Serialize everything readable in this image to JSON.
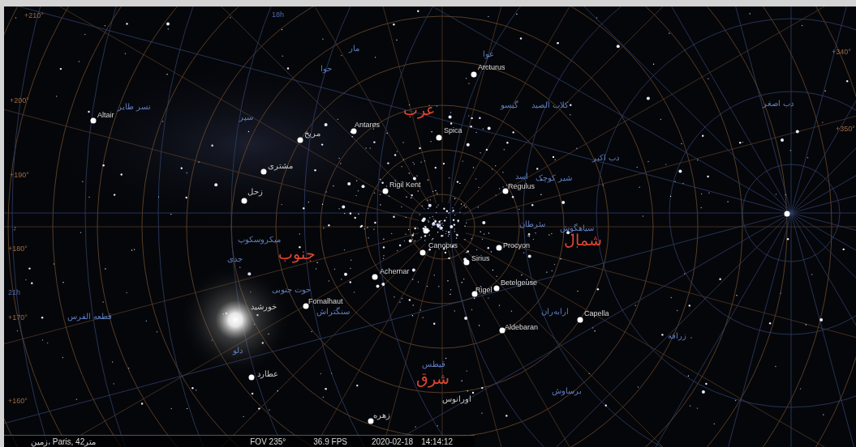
{
  "sky": {
    "labels": [
      {
        "kind": "hour",
        "text": "18h"
      },
      {
        "kind": "grid",
        "text": "+210°"
      },
      {
        "kind": "grid",
        "text": "+340°"
      },
      {
        "kind": "constellation",
        "text": "عوا"
      },
      {
        "kind": "constellation",
        "text": "مار"
      },
      {
        "kind": "star",
        "text": "Arcturus"
      },
      {
        "kind": "constellation",
        "text": "حوا"
      },
      {
        "kind": "constellation",
        "text": "دب اصغر"
      },
      {
        "kind": "constellation",
        "text": "کلاب الصید"
      },
      {
        "kind": "constellation",
        "text": "گیسو"
      },
      {
        "kind": "cardinal",
        "text": "غرب"
      },
      {
        "kind": "constellation",
        "text": "نسر طایر"
      },
      {
        "kind": "grid",
        "text": "+200°"
      },
      {
        "kind": "constellation",
        "text": "سپر"
      },
      {
        "kind": "star",
        "text": "Altair"
      },
      {
        "kind": "grid",
        "text": "+350°"
      },
      {
        "kind": "star",
        "text": "Spica"
      },
      {
        "kind": "star",
        "text": "Antares"
      },
      {
        "kind": "planet",
        "text": "مریخ"
      },
      {
        "kind": "constellation",
        "text": "دب اکبر"
      },
      {
        "kind": "planet",
        "text": "مشتری"
      },
      {
        "kind": "constellation",
        "text": "شیر کوچک"
      },
      {
        "kind": "constellation",
        "text": "اسد"
      },
      {
        "kind": "grid",
        "text": "+190°"
      },
      {
        "kind": "star",
        "text": "Regulus"
      },
      {
        "kind": "star",
        "text": "Rigil Kent"
      },
      {
        "kind": "planet",
        "text": "زحل"
      },
      {
        "kind": "constellation",
        "text": "سیاهگوش"
      },
      {
        "kind": "constellation",
        "text": "سرطان"
      },
      {
        "kind": "cardinal",
        "text": "شمال"
      },
      {
        "kind": "star",
        "text": "Procyon"
      },
      {
        "kind": "star",
        "text": "Canopus"
      },
      {
        "kind": "constellation",
        "text": "میکروسکوپ"
      },
      {
        "kind": "star",
        "text": "Sirius"
      },
      {
        "kind": "cardinal",
        "text": "جنوب"
      },
      {
        "kind": "grid",
        "text": "+180°"
      },
      {
        "kind": "constellation",
        "text": "جدی"
      },
      {
        "kind": "star",
        "text": "Achernar"
      },
      {
        "kind": "star",
        "text": "Betelgeuse"
      },
      {
        "kind": "star",
        "text": "Rigel"
      },
      {
        "kind": "constellation",
        "text": "حوت جنوبی"
      },
      {
        "kind": "hour",
        "text": "21h"
      },
      {
        "kind": "star",
        "text": "Fomalhaut"
      },
      {
        "kind": "star",
        "text": "Capella"
      },
      {
        "kind": "constellation",
        "text": "ارابه‌ران"
      },
      {
        "kind": "constellation",
        "text": "سنگتراش"
      },
      {
        "kind": "planet",
        "text": "خورشید"
      },
      {
        "kind": "constellation",
        "text": "قطعه الفرس"
      },
      {
        "kind": "grid",
        "text": "+170°"
      },
      {
        "kind": "star",
        "text": "Aldebaran"
      },
      {
        "kind": "constellation",
        "text": "زرافه"
      },
      {
        "kind": "constellation",
        "text": "دلو"
      },
      {
        "kind": "constellation",
        "text": "قیطس"
      },
      {
        "kind": "cardinal",
        "text": "شرق"
      },
      {
        "kind": "planet",
        "text": "عطارد"
      },
      {
        "kind": "constellation",
        "text": "برساوش"
      },
      {
        "kind": "planet",
        "text": "اورانوس"
      },
      {
        "kind": "grid",
        "text": "+160°"
      },
      {
        "kind": "planet",
        "text": "زهره"
      }
    ]
  },
  "status_bar": {
    "location": "زمین، Paris, 42متر",
    "fov": "FOV 235°",
    "fps": "36.9 FPS",
    "date": "2020-02-18",
    "time": "14:14:12"
  }
}
